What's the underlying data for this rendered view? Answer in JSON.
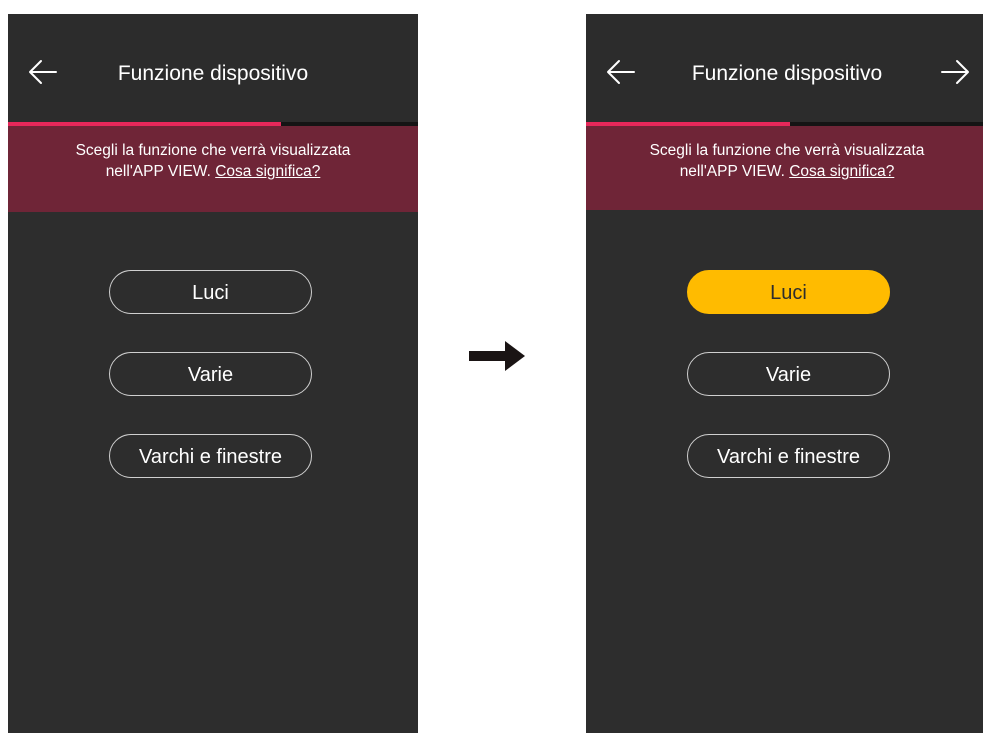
{
  "screens": [
    {
      "header": {
        "title": "Funzione dispositivo",
        "back_icon": "arrow-left-icon"
      },
      "banner": {
        "text": "Scegli la funzione che verrà visualizzata",
        "text2": "nell'APP VIEW.",
        "link": "Cosa significa?"
      },
      "progress": 0.67,
      "options": [
        {
          "label": "Luci",
          "selected": false
        },
        {
          "label": "Varie",
          "selected": false
        },
        {
          "label": "Varchi e finestre",
          "selected": false
        }
      ]
    },
    {
      "header": {
        "title": "Funzione dispositivo",
        "back_icon": "arrow-left-icon",
        "forward_icon": "arrow-right-icon"
      },
      "banner": {
        "text": "Scegli la funzione che verrà visualizzata",
        "text2": "nell'APP VIEW.",
        "link": "Cosa significa?"
      },
      "progress": 0.51,
      "options": [
        {
          "label": "Luci",
          "selected": true
        },
        {
          "label": "Varie",
          "selected": false
        },
        {
          "label": "Varchi e finestre",
          "selected": false
        }
      ]
    }
  ],
  "transition_icon": "arrow-right-icon",
  "colors": {
    "background": "#2d2d2d",
    "banner": "#6f2537",
    "progress": "#e6285a",
    "selected": "#ffbb00"
  }
}
